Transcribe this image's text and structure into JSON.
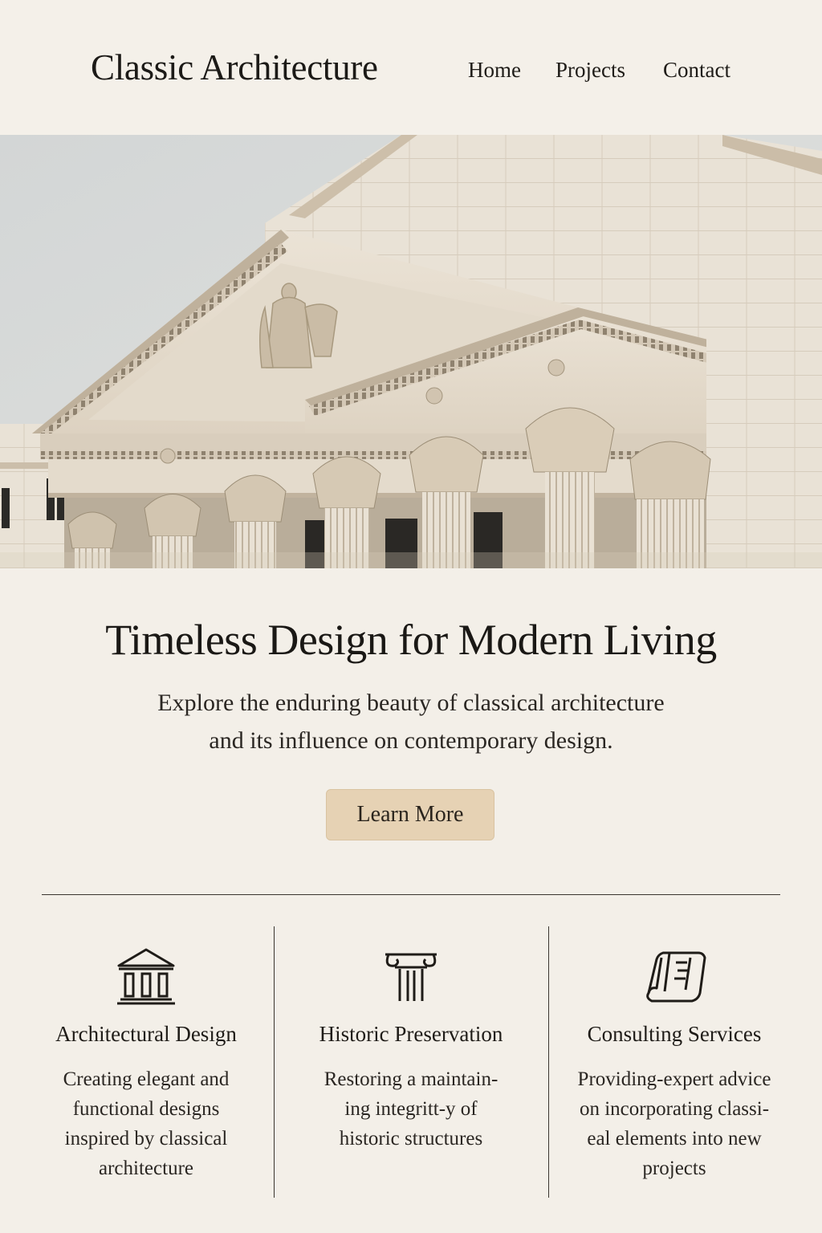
{
  "header": {
    "site_title": "Classic Architecture",
    "nav": [
      "Home",
      "Projects",
      "Contact"
    ]
  },
  "hero": {
    "image_alt": "Neoclassical building facade with pediment and Corinthian columns",
    "headline": "Timeless Design for Modern Living",
    "subtext_line1": "Explore the enduring beauty of classical architecture",
    "subtext_line2": "and its influence on contemporary design.",
    "cta_label": "Learn More"
  },
  "services": [
    {
      "icon": "temple-icon",
      "title": "Architectural Design",
      "desc": [
        "Creating elegant and",
        "functional designs",
        "inspired by classical",
        "architecture"
      ]
    },
    {
      "icon": "column-icon",
      "title": "Historic Preservation",
      "desc": [
        "Restoring a maintain-",
        "ing integritt-y of",
        "historic structures"
      ]
    },
    {
      "icon": "blueprint-icon",
      "title": "Consulting Services",
      "desc": [
        "Providing-expert advice",
        "on incorporating classi-",
        "eal elements into new",
        "projects"
      ]
    }
  ],
  "colors": {
    "background": "#f3efe8",
    "cta_background": "#e6d2b4",
    "text": "#1f1c18",
    "divider": "#3a352f"
  }
}
